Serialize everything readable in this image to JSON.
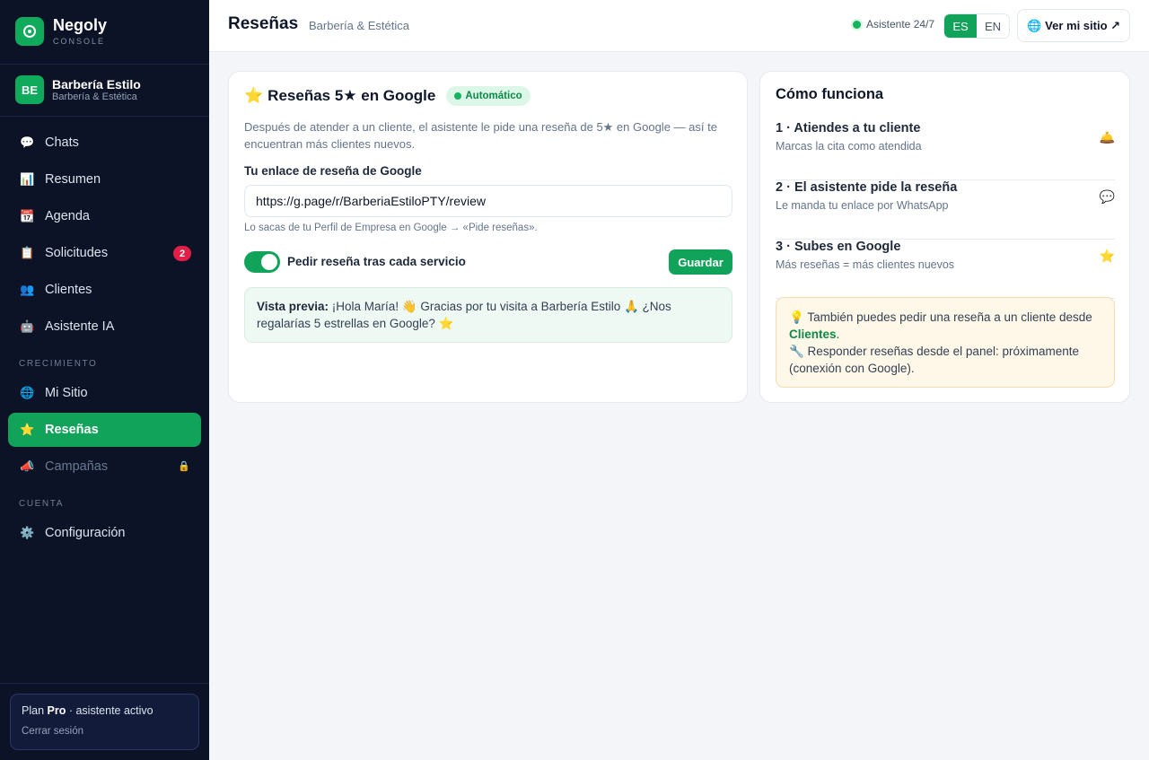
{
  "brand": {
    "name": "Negoly",
    "sub": "CONSOLE",
    "logo_icon": "target-logo-icon"
  },
  "business": {
    "initials": "BE",
    "name": "Barbería Estilo",
    "category": "Barbería & Estética"
  },
  "nav": {
    "main": [
      {
        "icon": "💬",
        "label": "Chats"
      },
      {
        "icon": "📊",
        "label": "Resumen"
      },
      {
        "icon": "📆",
        "label": "Agenda"
      },
      {
        "icon": "📋",
        "label": "Solicitudes",
        "badge": "2"
      },
      {
        "icon": "👥",
        "label": "Clientes"
      },
      {
        "icon": "🤖",
        "label": "Asistente IA"
      }
    ],
    "growth_label": "CRECIMIENTO",
    "growth": [
      {
        "icon": "🌐",
        "label": "Mi Sitio"
      },
      {
        "icon": "⭐",
        "label": "Reseñas"
      },
      {
        "icon": "📣",
        "label": "Campañas",
        "lock": "🔒"
      }
    ],
    "account_label": "CUENTA",
    "account": [
      {
        "icon": "⚙️",
        "label": "Configuración"
      }
    ]
  },
  "plan": {
    "prefix": "Plan",
    "name": "Pro",
    "suffix": "· asistente activo",
    "logout": "Cerrar sesión"
  },
  "header": {
    "title": "Reseñas",
    "subtitle": "Barbería & Estética",
    "status": "Asistente 24/7",
    "lang_es": "ES",
    "lang_en": "EN",
    "site_icon": "🌐",
    "site_label": "Ver mi sitio ↗"
  },
  "reviews_card": {
    "title_icon": "⭐",
    "title": "Reseñas 5★ en Google",
    "pill": "Automático",
    "description": "Después de atender a un cliente, el asistente le pide una reseña de 5★ en Google — así te encuentran más clientes nuevos.",
    "field_label": "Tu enlace de reseña de Google",
    "link_value": "https://g.page/r/BarberiaEstiloPTY/review",
    "hint": "Lo sacas de tu Perfil de Empresa en Google → «Pide reseñas».",
    "toggle_label": "Pedir reseña tras cada servicio",
    "toggle_on": true,
    "save_label": "Guardar",
    "preview_label": "Vista previa:",
    "preview_text": " ¡Hola María! 👋 Gracias por tu visita a Barbería Estilo 🙏 ¿Nos regalarías 5 estrellas en Google? ⭐"
  },
  "how_card": {
    "title": "Cómo funciona",
    "steps": [
      {
        "title": "1 · Atiendes a tu cliente",
        "sub": "Marcas la cita como atendida",
        "icon": "🛎️"
      },
      {
        "title": "2 · El asistente pide la reseña",
        "sub": "Le manda tu enlace por WhatsApp",
        "icon": "💬"
      },
      {
        "title": "3 · Subes en Google",
        "sub": "Más reseñas = más clientes nuevos",
        "icon": "⭐"
      }
    ],
    "tip_line1": "💡 También puedes pedir una reseña a un cliente desde ",
    "tip_link": "Clientes",
    "tip_line1_end": ".",
    "tip_line2": "🔧 Responder reseñas desde el panel: próximamente (conexión con Google)."
  }
}
